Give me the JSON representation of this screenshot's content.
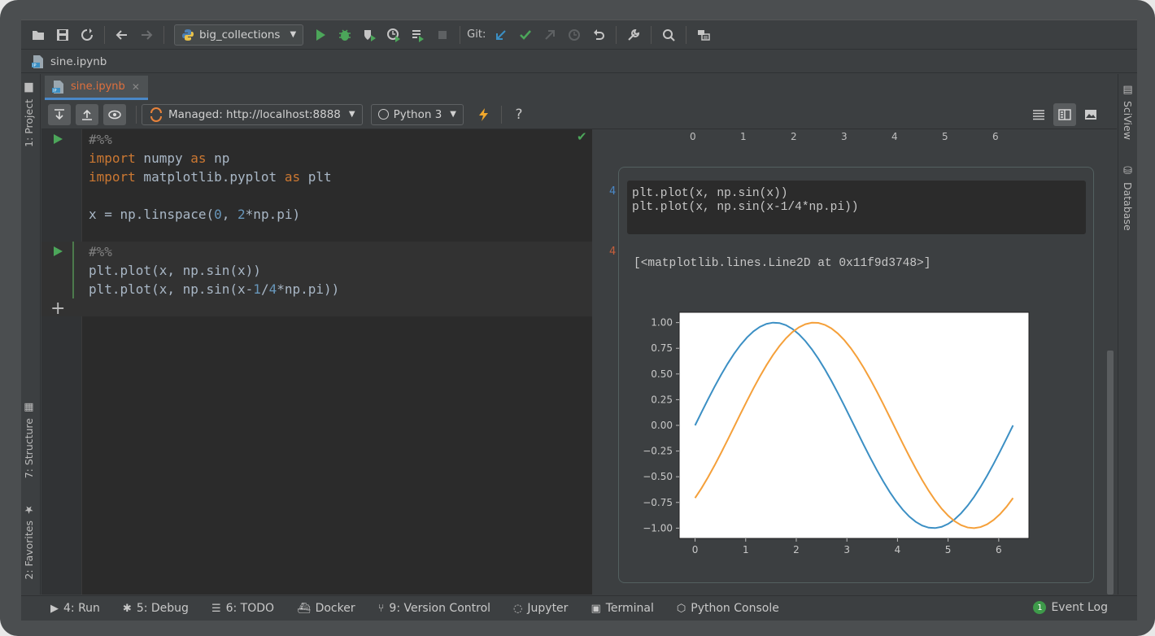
{
  "toolbar": {
    "run_config": "big_collections",
    "git_label": "Git:"
  },
  "breadcrumb": {
    "file": "sine.ipynb"
  },
  "left_strip": {
    "project": "1: Project",
    "structure": "7: Structure",
    "favorites": "2: Favorites"
  },
  "right_strip": {
    "sciview": "SciView",
    "database": "Database"
  },
  "tab": {
    "label": "sine.ipynb",
    "close": "✕"
  },
  "notebook_toolbar": {
    "server": "Managed: http://localhost:8888",
    "kernel": "Python 3",
    "help": "?"
  },
  "code": {
    "cell1": [
      "#%%",
      "import numpy as np",
      "import matplotlib.pyplot as plt",
      "",
      "x = np.linspace(0, 2*np.pi)"
    ],
    "cell2": [
      "#%%",
      "plt.plot(x, np.sin(x))",
      "plt.plot(x, np.sin(x-1/4*np.pi))"
    ]
  },
  "output": {
    "in_num": "4",
    "out_num": "4",
    "code_lines": "plt.plot(x, np.sin(x))\nplt.plot(x, np.sin(x-1/4*np.pi))",
    "text": "[<matplotlib.lines.Line2D at 0x11f9d3748>]",
    "top_ticks": [
      "0",
      "1",
      "2",
      "3",
      "4",
      "5",
      "6"
    ]
  },
  "statusbar": {
    "run": "4: Run",
    "debug": "5: Debug",
    "todo": "6: TODO",
    "docker": "Docker",
    "vcs": "9: Version Control",
    "jupyter": "Jupyter",
    "terminal": "Terminal",
    "console": "Python Console",
    "event_log": "Event Log",
    "event_count": "1"
  },
  "colors": {
    "accent": "#4a88c7",
    "run_green": "#4ca65a",
    "series1": "#3b8fc4",
    "series2": "#f5a03a"
  },
  "chart_data": {
    "type": "line",
    "x_range": [
      0,
      6.283
    ],
    "ylim": [
      -1.0,
      1.0
    ],
    "xticks": [
      "0",
      "1",
      "2",
      "3",
      "4",
      "5",
      "6"
    ],
    "yticks": [
      "1.00",
      "0.75",
      "0.50",
      "0.25",
      "0.00",
      "−0.25",
      "−0.50",
      "−0.75",
      "−1.00"
    ],
    "series": [
      {
        "function": "sin(x)",
        "color": "#3b8fc4",
        "samples": 50
      },
      {
        "function": "sin(x-pi/4)",
        "color": "#f5a03a",
        "samples": 50
      }
    ]
  }
}
